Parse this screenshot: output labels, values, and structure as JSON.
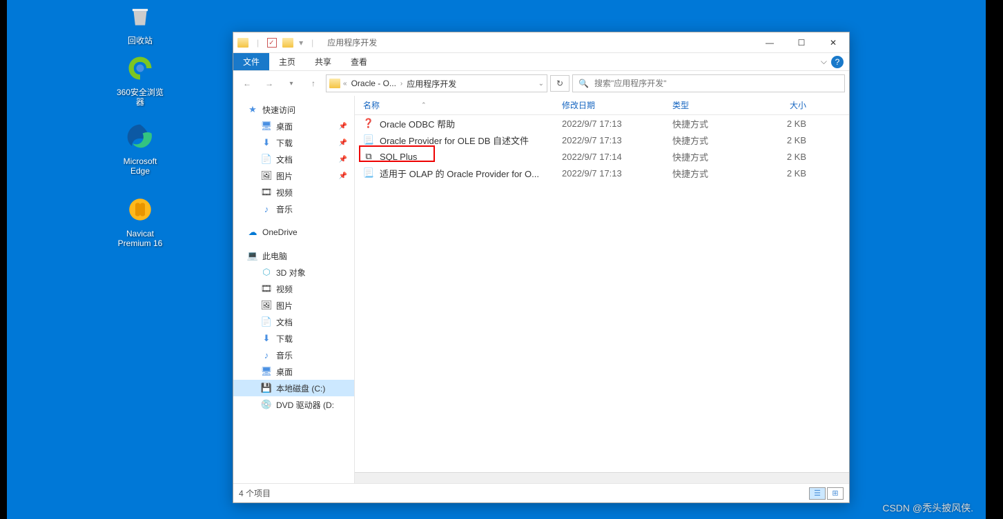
{
  "desktop": {
    "recycle_bin": "回收站",
    "browser360": "360安全浏览器",
    "edge": "Microsoft Edge",
    "navicat": "Navicat Premium 16"
  },
  "window": {
    "title": "应用程序开发",
    "tabs": {
      "file": "文件",
      "home": "主页",
      "share": "共享",
      "view": "查看"
    },
    "breadcrumb": {
      "item1": "Oracle - O...",
      "item2": "应用程序开发"
    },
    "search_placeholder": "搜索\"应用程序开发\""
  },
  "sidebar": {
    "quick_access": "快速访问",
    "desktop": "桌面",
    "downloads": "下载",
    "documents": "文档",
    "pictures": "图片",
    "videos": "视频",
    "music": "音乐",
    "onedrive": "OneDrive",
    "this_pc": "此电脑",
    "objects_3d": "3D 对象",
    "videos2": "视频",
    "pictures2": "图片",
    "documents2": "文档",
    "downloads2": "下载",
    "music2": "音乐",
    "desktop2": "桌面",
    "local_disk": "本地磁盘 (C:)",
    "dvd_drive": "DVD 驱动器 (D:"
  },
  "columns": {
    "name": "名称",
    "date": "修改日期",
    "type": "类型",
    "size": "大小"
  },
  "files": [
    {
      "name": "Oracle ODBC 帮助",
      "date": "2022/9/7 17:13",
      "type": "快捷方式",
      "size": "2 KB"
    },
    {
      "name": "Oracle Provider for OLE DB 自述文件",
      "date": "2022/9/7 17:13",
      "type": "快捷方式",
      "size": "2 KB"
    },
    {
      "name": "SQL Plus",
      "date": "2022/9/7 17:14",
      "type": "快捷方式",
      "size": "2 KB"
    },
    {
      "name": "适用于 OLAP 的 Oracle Provider for O...",
      "date": "2022/9/7 17:13",
      "type": "快捷方式",
      "size": "2 KB"
    }
  ],
  "status": {
    "item_count": "4 个项目"
  },
  "watermark": "CSDN @秃头披风侠."
}
